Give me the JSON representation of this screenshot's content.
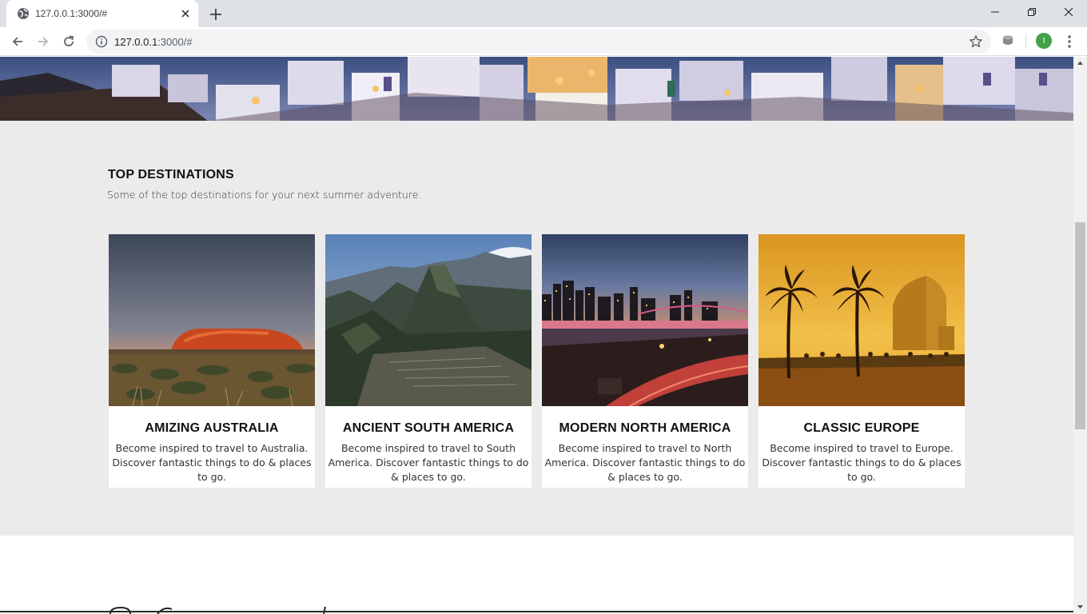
{
  "browser": {
    "tab_title": "127.0.0.1:3000/#",
    "url_host": "127.0.0.1",
    "url_rest": ":3000/#",
    "profile_initial": "I"
  },
  "destinations": {
    "heading": "TOP DESTINATIONS",
    "subtitle": "Some of the top destinations for your next summer adventure.",
    "cards": [
      {
        "title": "AMIZING AUSTRALIA",
        "description": "Become inspired to travel to Australia. Discover fantastic things to do & places to go."
      },
      {
        "title": "ANCIENT SOUTH AMERICA",
        "description": "Become inspired to travel to South America. Discover fantastic things to do & places to go."
      },
      {
        "title": "MODERN NORTH AMERICA",
        "description": "Become inspired to travel to North America. Discover fantastic things to do & places to go."
      },
      {
        "title": "CLASSIC EUROPE",
        "description": "Become inspired to travel to Europe. Discover fantastic things to do & places to go."
      }
    ]
  }
}
